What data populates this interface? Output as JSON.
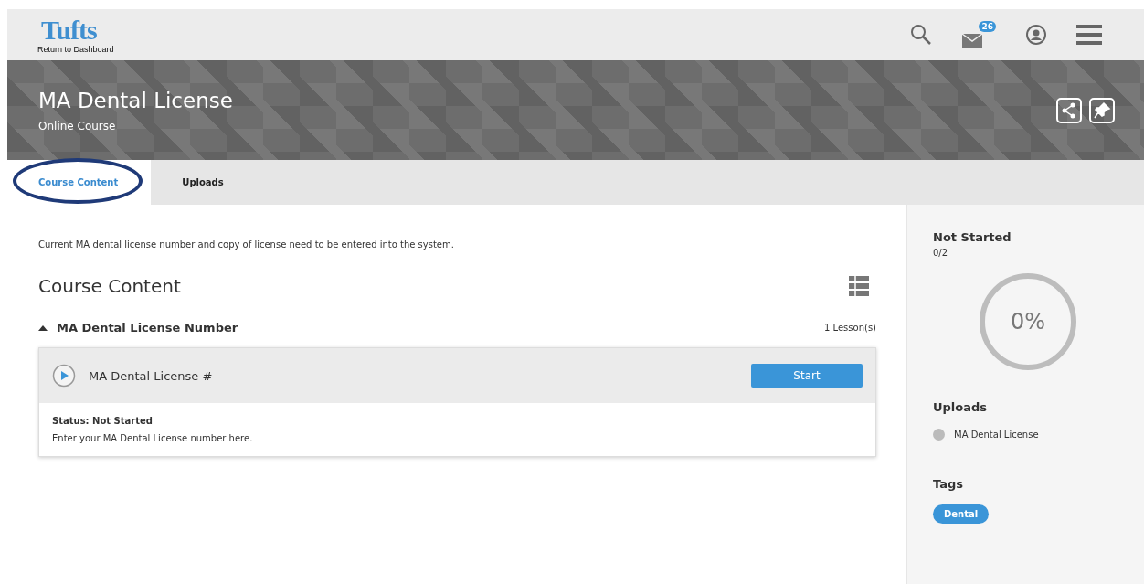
{
  "header": {
    "logo": "Tufts",
    "back_link": "Return to Dashboard",
    "mail_count": "26"
  },
  "banner": {
    "title": "MA Dental License",
    "subtitle": "Online Course"
  },
  "tabs": [
    {
      "label": "Course Content",
      "selected": true,
      "circled": true
    },
    {
      "label": "Uploads",
      "selected": false,
      "circled": false
    }
  ],
  "description": "Current MA dental license number and copy of license need to be entered into the system.",
  "content_heading": "Course Content",
  "sections": [
    {
      "title": "MA Dental License Number",
      "expanded": true,
      "count": "1 Lesson(s)",
      "lessons": [
        {
          "title": "MA Dental License #",
          "button": "Start",
          "status": "Status: Not Started",
          "note": "Enter your MA Dental License number here."
        }
      ]
    }
  ],
  "sidebar": {
    "status": "Not Started",
    "fraction": "0/2",
    "progress": {
      "level": 0,
      "label": "0%"
    },
    "uploads_heading": "Uploads",
    "uploads": [
      {
        "label": "MA Dental License",
        "color": "#bbbbbb"
      }
    ],
    "tags_heading": "Tags",
    "tags": [
      "Dental"
    ]
  }
}
